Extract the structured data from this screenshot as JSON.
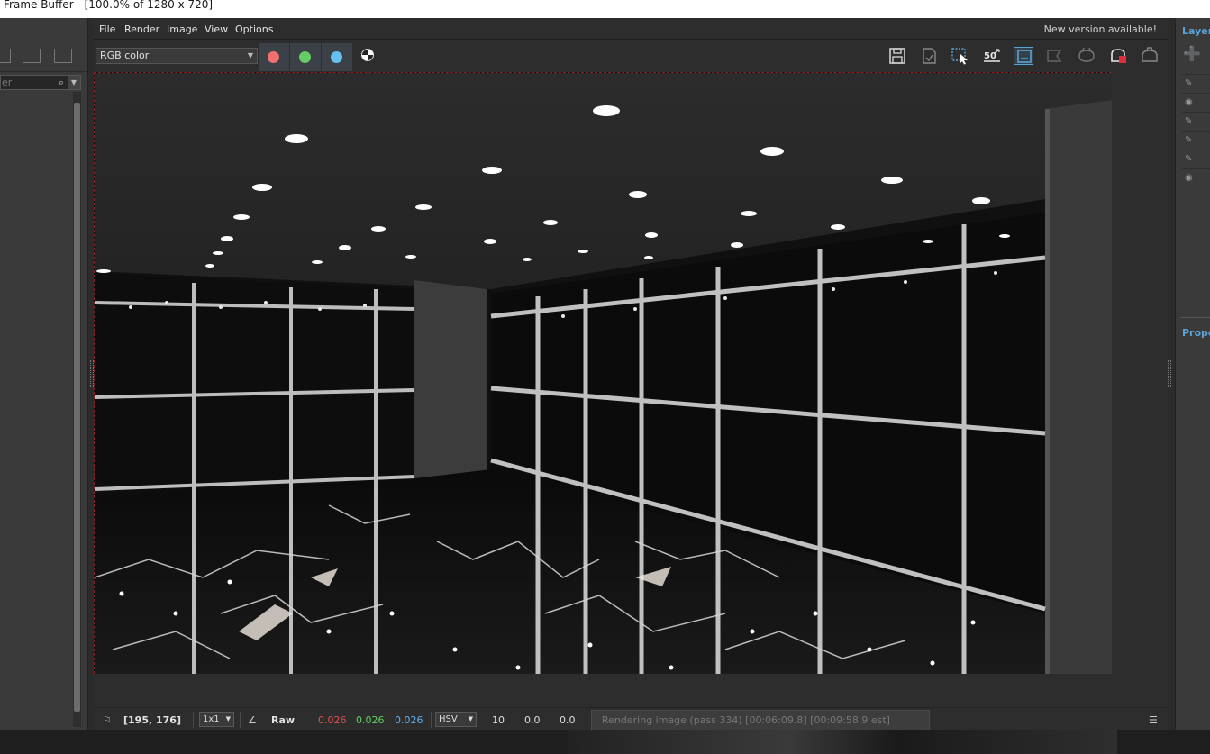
{
  "window": {
    "title": "Frame Buffer - [100.0% of 1280 x 720]"
  },
  "menu": {
    "items": [
      "File",
      "Render",
      "Image",
      "View",
      "Options"
    ],
    "notice": "New version available!"
  },
  "left_panel": {
    "filter_placeholder": "er"
  },
  "toolbar": {
    "channel": "RGB color",
    "channel_colors": {
      "red": "#f07070",
      "green": "#66cc66",
      "blue": "#66c0f0"
    },
    "zoom_icon_text": "50",
    "icons": [
      "save-icon",
      "save-all-icon",
      "region-render-icon",
      "zoom-50-icon",
      "track-mouse-icon",
      "render-region-icon",
      "clear-icon",
      "render-interactive-icon",
      "stop-render-icon",
      "render-icon"
    ]
  },
  "right_panel": {
    "layers_title": "Layers",
    "properties_title": "Properties"
  },
  "status": {
    "coords": "[195, 176]",
    "sample_size": "1x1",
    "mode": "Raw",
    "r": "0.026",
    "g": "0.026",
    "b": "0.026",
    "color_space": "HSV",
    "h": "10",
    "s": "0.0",
    "v": "0.0",
    "progress_text": "Rendering image (pass 334) [00:06:09.8] [00:09:58.9 est]",
    "colors": {
      "r": "#e05050",
      "g": "#60d060",
      "b": "#60b0f0"
    }
  }
}
